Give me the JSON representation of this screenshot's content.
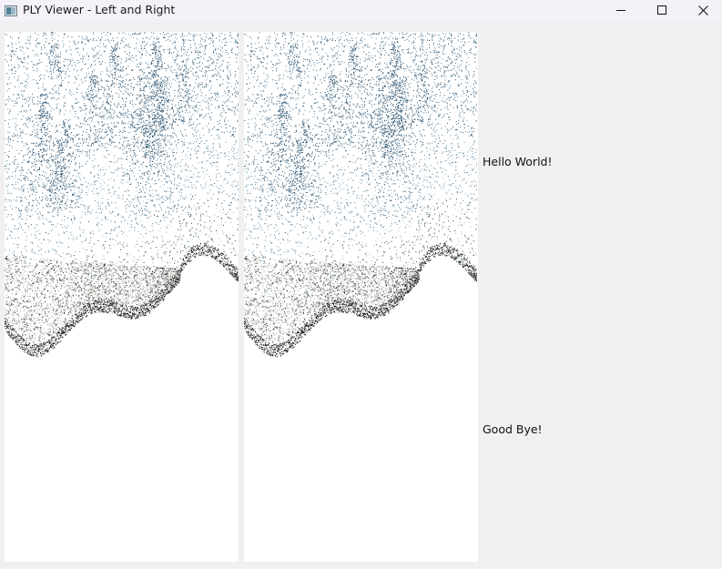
{
  "window": {
    "title": "PLY Viewer - Left and Right",
    "app_icon": "ply-viewer-app-icon",
    "controls": {
      "minimize_icon": "minimize-icon",
      "maximize_icon": "maximize-icon",
      "close_icon": "close-icon"
    }
  },
  "views": {
    "left": {
      "name": "left-point-cloud-view",
      "content": "point-cloud-render"
    },
    "right": {
      "name": "right-point-cloud-view",
      "content": "point-cloud-render"
    }
  },
  "side_panel": {
    "hello_label": "Hello World!",
    "bye_label": "Good Bye!"
  },
  "colors": {
    "window_bg": "#f0f0f0",
    "titlebar_bg": "#f3f2f8",
    "view_bg": "#ffffff",
    "points_dark": "#2e5470",
    "points_mid": "#5c8aa6",
    "points_light": "#9fb9c8",
    "ground_gray": "#b4b4aa",
    "ground_dark": "#141414"
  }
}
